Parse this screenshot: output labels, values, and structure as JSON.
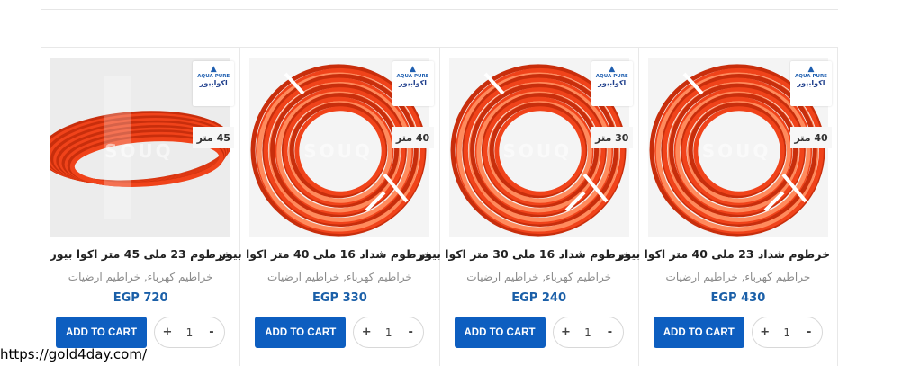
{
  "products": [
    {
      "title": "خرطوم 23 ملى 45 متر اكوا بيور",
      "categories": "خراطيم كهرباء, خراطيم ارضيات",
      "price": "EGP 720",
      "length_badge": "45 متر",
      "brand": {
        "en": "AQUA PURE",
        "ar": "اكوابيور"
      },
      "watermark": "SOUQ",
      "add_to_cart": "ADD TO CART",
      "qty": {
        "minus": "-",
        "value": "1",
        "plus": "+"
      },
      "image_style": "loose"
    },
    {
      "title": "خرطوم شداد 16 ملى 40 متر اكوا بيور",
      "categories": "خراطيم كهرباء, خراطيم ارضيات",
      "price": "EGP 330",
      "length_badge": "40 متر",
      "brand": {
        "en": "AQUA PURE",
        "ar": "اكوابيور"
      },
      "watermark": "SOUQ",
      "add_to_cart": "ADD TO CART",
      "qty": {
        "minus": "-",
        "value": "1",
        "plus": "+"
      },
      "image_style": "coil"
    },
    {
      "title": "خرطوم شداد 16 ملى 30 متر اكوا بيور",
      "categories": "خراطيم كهرباء, خراطيم ارضيات",
      "price": "EGP 240",
      "length_badge": "30 متر",
      "brand": {
        "en": "AQUA PURE",
        "ar": "اكوابيور"
      },
      "watermark": "SOUQ",
      "add_to_cart": "ADD TO CART",
      "qty": {
        "minus": "-",
        "value": "1",
        "plus": "+"
      },
      "image_style": "coil"
    },
    {
      "title": "خرطوم شداد 23 ملى 40 متر اكوا بيور",
      "categories": "خراطيم كهرباء, خراطيم ارضيات",
      "price": "EGP 430",
      "length_badge": "40 متر",
      "brand": {
        "en": "AQUA PURE",
        "ar": "اكوابيور"
      },
      "watermark": "SOUQ",
      "add_to_cart": "ADD TO CART",
      "qty": {
        "minus": "-",
        "value": "1",
        "plus": "+"
      },
      "image_style": "coil"
    }
  ],
  "url_caption": "https://gold4day.com/",
  "colors": {
    "accent": "#0d5ec0",
    "price": "#1a5fa8",
    "hose": "#f0431a",
    "hose_dark": "#c82e0c",
    "hose_light": "#ff8a5c",
    "strap": "#ffffff"
  }
}
